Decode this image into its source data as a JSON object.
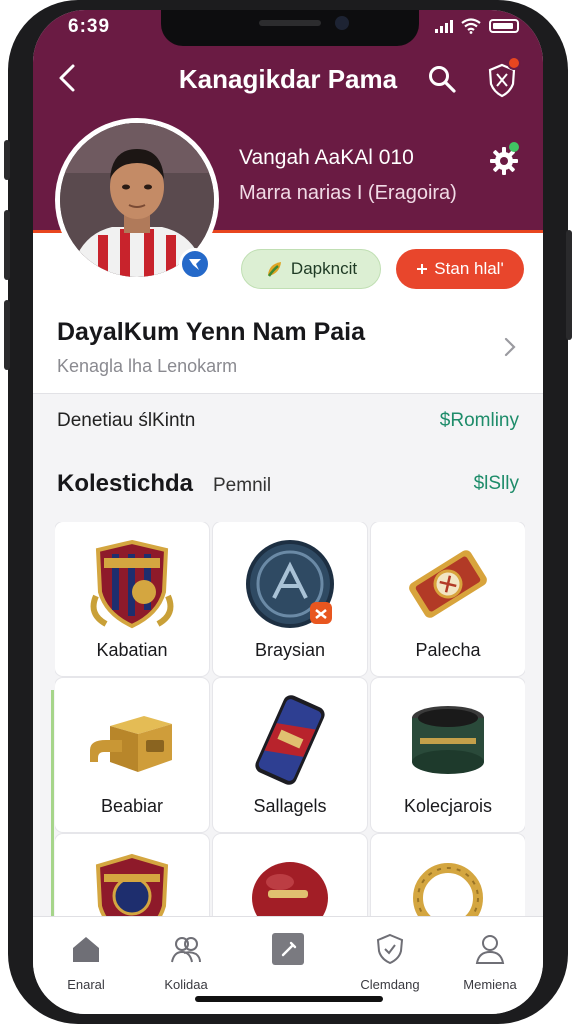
{
  "status_bar": {
    "time": "6:39"
  },
  "header": {
    "title": "Kanagikdar Pama",
    "profile_name": "Vangah AaKAl 010",
    "profile_subtitle": "Marra narias I (Eragoira)"
  },
  "actions": {
    "primary_label": "Dapkncit",
    "secondary_label": "Stan hlal'"
  },
  "title_card": {
    "title": "DayalKum Yenn Nam Paia",
    "subtitle": "Kenagla lha Lenokarm"
  },
  "info_row": {
    "label": "Denetiau ślKintn",
    "value": "$Romliny"
  },
  "collection": {
    "title": "Kolestichda",
    "subtitle": "Pemnil",
    "value": "$lSlly",
    "items": [
      {
        "label": "Kabatian",
        "icon": "shield-crest-icon"
      },
      {
        "label": "Braysian",
        "icon": "medal-badge-icon"
      },
      {
        "label": "Palecha",
        "icon": "ticket-card-icon"
      },
      {
        "label": "Beabiar",
        "icon": "gold-box-icon"
      },
      {
        "label": "Sallagels",
        "icon": "phone-case-icon"
      },
      {
        "label": "Kolecjarois",
        "icon": "tin-can-icon"
      },
      {
        "label": "",
        "icon": "crest-emblem-icon"
      },
      {
        "label": "",
        "icon": "red-ball-icon"
      },
      {
        "label": "",
        "icon": "gold-ring-icon"
      }
    ]
  },
  "tabs": [
    {
      "label": "Enaral",
      "icon": "home-icon"
    },
    {
      "label": "Kolidaa",
      "icon": "users-icon"
    },
    {
      "label": "",
      "icon": "edit-square-icon"
    },
    {
      "label": "Clemdang",
      "icon": "shield-check-icon"
    },
    {
      "label": "Memiena",
      "icon": "profile-icon"
    }
  ],
  "colors": {
    "header": "#6a1b43",
    "accent_red": "#e8462c",
    "accent_green": "#1e8c6a",
    "pill_green": "#dcefd3"
  }
}
